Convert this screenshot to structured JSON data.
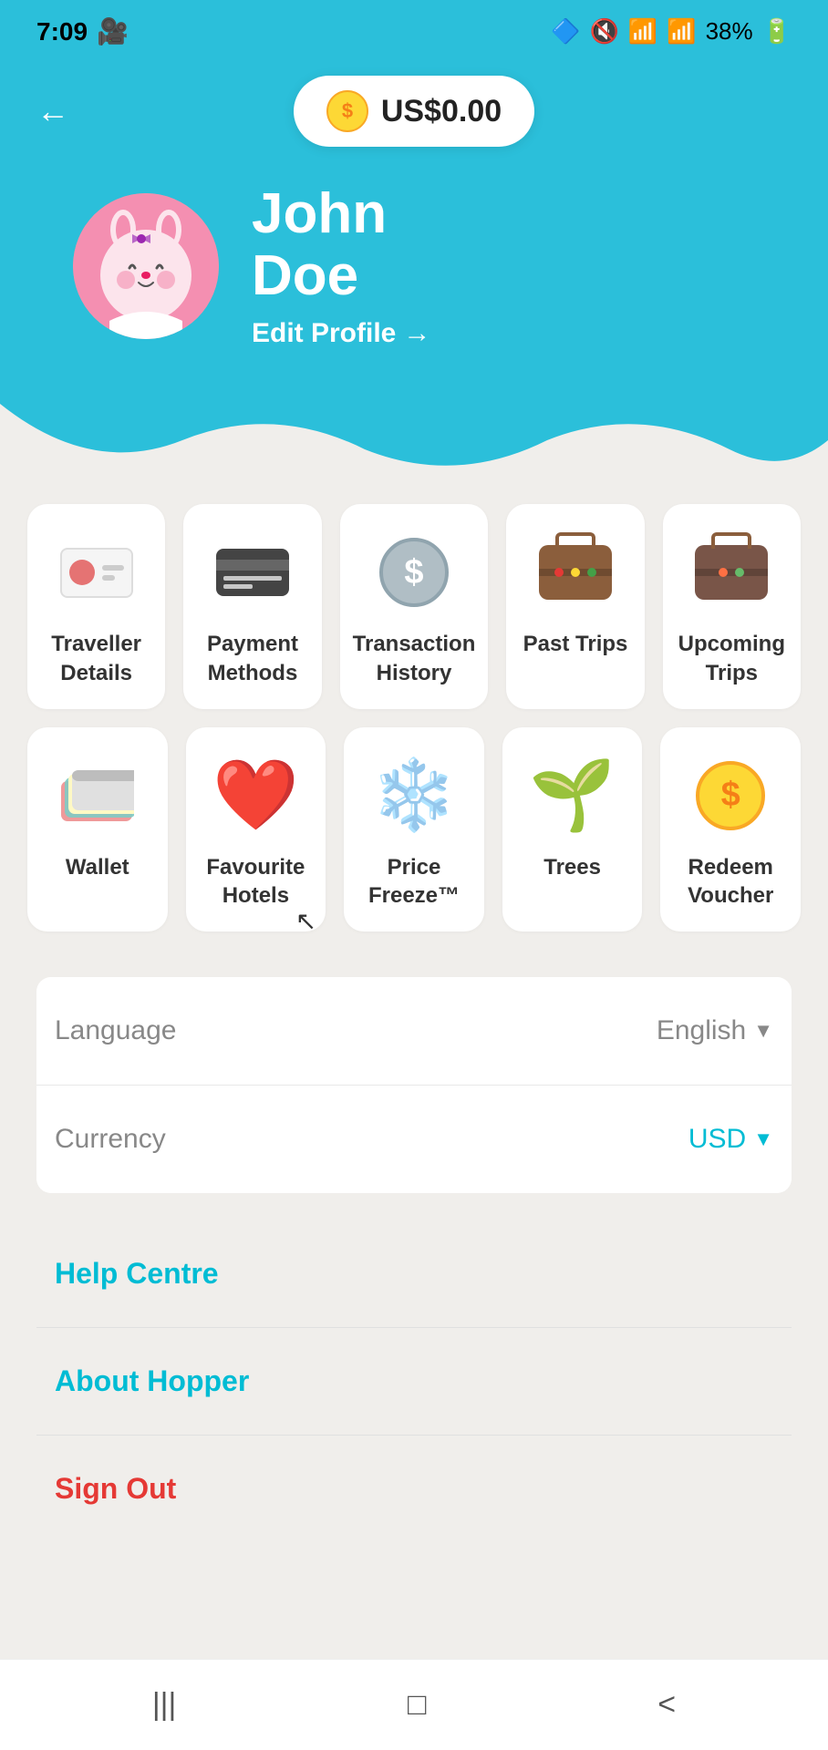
{
  "statusBar": {
    "time": "7:09",
    "battery": "38%"
  },
  "header": {
    "balance": "US$0.00",
    "backLabel": "←"
  },
  "profile": {
    "name": "John",
    "lastName": "Doe",
    "editLabel": "Edit Profile",
    "editArrow": "→"
  },
  "menuRow1": [
    {
      "id": "traveller-details",
      "label": "Traveller\nDetails",
      "icon": "traveller"
    },
    {
      "id": "payment-methods",
      "label": "Payment\nMethods",
      "icon": "payment"
    },
    {
      "id": "transaction-history",
      "label": "Transaction\nHistory",
      "icon": "transaction"
    },
    {
      "id": "past-trips",
      "label": "Past Trips",
      "icon": "past-trips"
    },
    {
      "id": "upcoming-trips",
      "label": "Upcoming\nTrips",
      "icon": "upcoming-trips"
    }
  ],
  "menuRow2": [
    {
      "id": "wallet",
      "label": "Wallet",
      "icon": "wallet"
    },
    {
      "id": "favourite-hotels",
      "label": "Favourite\nHotels",
      "icon": "heart"
    },
    {
      "id": "price-freeze",
      "label": "Price\nFreeze™",
      "icon": "snowflake"
    },
    {
      "id": "trees",
      "label": "Trees",
      "icon": "trees"
    },
    {
      "id": "redeem-voucher",
      "label": "Redeem\nVoucher",
      "icon": "voucher"
    }
  ],
  "settings": {
    "languageLabel": "Language",
    "languageValue": "English",
    "currencyLabel": "Currency",
    "currencyValue": "USD"
  },
  "links": {
    "helpCentre": "Help Centre",
    "aboutHopper": "About Hopper",
    "signOut": "Sign Out"
  },
  "bottomNav": {
    "menu": "|||",
    "home": "□",
    "back": "<"
  }
}
